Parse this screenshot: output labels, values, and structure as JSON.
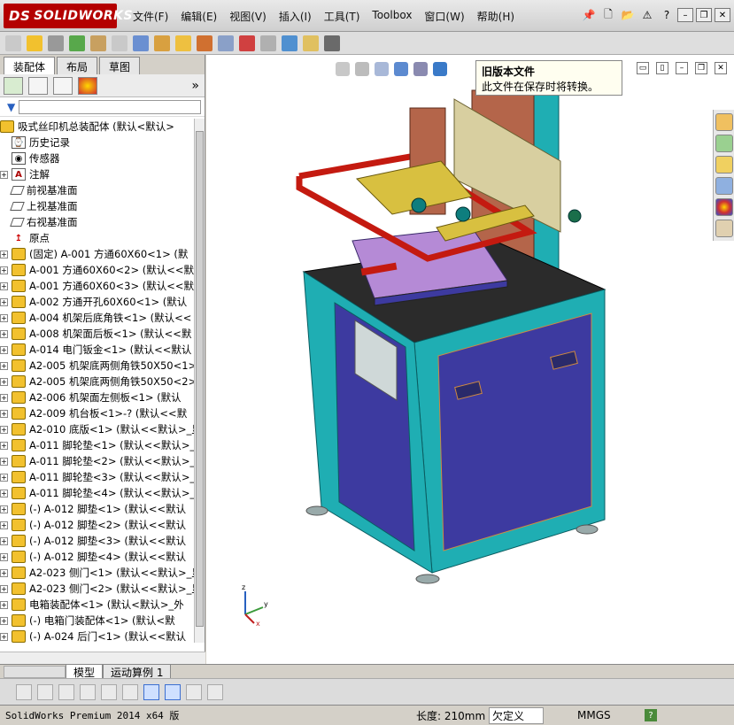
{
  "app": {
    "logo": "SOLIDWORKS",
    "logo_prefix": "DS"
  },
  "menu": [
    "文件(F)",
    "编辑(E)",
    "视图(V)",
    "插入(I)",
    "工具(T)",
    "Toolbox",
    "窗口(W)",
    "帮助(H)"
  ],
  "panel_tabs": [
    "装配体",
    "布局",
    "草图"
  ],
  "tree": {
    "root": "吸式丝印机总装配体  (默认<默认>",
    "items": [
      {
        "label": "历史记录",
        "icon": "history-icon",
        "expand": false
      },
      {
        "label": "传感器",
        "icon": "sensor-icon",
        "expand": false
      },
      {
        "label": "注解",
        "icon": "annotation-icon",
        "expand": true
      },
      {
        "label": "前视基准面",
        "icon": "plane-icon",
        "expand": false
      },
      {
        "label": "上视基准面",
        "icon": "plane-icon",
        "expand": false
      },
      {
        "label": "右视基准面",
        "icon": "plane-icon",
        "expand": false
      },
      {
        "label": "原点",
        "icon": "origin-icon",
        "expand": false
      },
      {
        "label": "(固定) A-001 方通60X60<1> (默",
        "icon": "part-icon",
        "expand": true
      },
      {
        "label": "A-001 方通60X60<2> (默认<<默认",
        "icon": "part-icon",
        "expand": true
      },
      {
        "label": "A-001 方通60X60<3> (默认<<默认",
        "icon": "part-icon",
        "expand": true
      },
      {
        "label": "A-002 方通开孔60X60<1> (默认",
        "icon": "part-icon",
        "expand": true
      },
      {
        "label": "A-004 机架后底角铁<1> (默认<<",
        "icon": "part-icon",
        "expand": true
      },
      {
        "label": "A-008 机架面后板<1> (默认<<默",
        "icon": "part-icon",
        "expand": true
      },
      {
        "label": "A-014 电门钣金<1> (默认<<默认",
        "icon": "part-icon",
        "expand": true
      },
      {
        "label": "A2-005 机架底两侧角铁50X50<1>",
        "icon": "part-icon",
        "expand": true
      },
      {
        "label": "A2-005 机架底两侧角铁50X50<2>",
        "icon": "part-icon",
        "expand": true
      },
      {
        "label": "A2-006 机架面左侧板<1> (默认",
        "icon": "part-icon",
        "expand": true
      },
      {
        "label": "A2-009 机台板<1>-? (默认<<默",
        "icon": "part-icon",
        "expand": true
      },
      {
        "label": "A2-010 底版<1> (默认<<默认>_显",
        "icon": "part-icon",
        "expand": true
      },
      {
        "label": "A-011 脚轮垫<1> (默认<<默认>_",
        "icon": "part-icon",
        "expand": true
      },
      {
        "label": "A-011 脚轮垫<2> (默认<<默认>_",
        "icon": "part-icon",
        "expand": true
      },
      {
        "label": "A-011 脚轮垫<3> (默认<<默认>_",
        "icon": "part-icon",
        "expand": true
      },
      {
        "label": "A-011 脚轮垫<4> (默认<<默认>_",
        "icon": "part-icon",
        "expand": true
      },
      {
        "label": "(-) A-012 脚垫<1> (默认<<默认",
        "icon": "part-icon",
        "expand": true
      },
      {
        "label": "(-) A-012 脚垫<2> (默认<<默认",
        "icon": "part-icon",
        "expand": true
      },
      {
        "label": "(-) A-012 脚垫<3> (默认<<默认",
        "icon": "part-icon",
        "expand": true
      },
      {
        "label": "(-) A-012 脚垫<4> (默认<<默认",
        "icon": "part-icon",
        "expand": true
      },
      {
        "label": "A2-023 侧门<1> (默认<<默认>_显",
        "icon": "part-icon",
        "expand": true
      },
      {
        "label": "A2-023 侧门<2> (默认<<默认>_显",
        "icon": "part-icon",
        "expand": true
      },
      {
        "label": "电箱装配体<1> (默认<默认>_外",
        "icon": "assembly-icon",
        "expand": true
      },
      {
        "label": "(-) 电箱门装配体<1> (默认<默",
        "icon": "assembly-icon",
        "expand": true
      },
      {
        "label": "(-) A-024 后门<1> (默认<<默认",
        "icon": "part-icon",
        "expand": true
      }
    ]
  },
  "tooltip": {
    "title": "旧版本文件",
    "body": "此文件在保存时将转换。"
  },
  "bottom_tabs": [
    "模型",
    "运动算例 1"
  ],
  "status": {
    "app": "SolidWorks Premium 2014 x64 版",
    "length": "长度: 210mm",
    "state": "欠定义",
    "units": "MMGS",
    "help": "?"
  },
  "triad": {
    "x": "x",
    "y": "y",
    "z": "z"
  },
  "colors": {
    "frame": "#1faeb3",
    "panel": "#3d3aa0",
    "rail": "#c41a10",
    "table": "#b58ad6",
    "column": "#b4654a",
    "top": "#2b2b2b"
  }
}
